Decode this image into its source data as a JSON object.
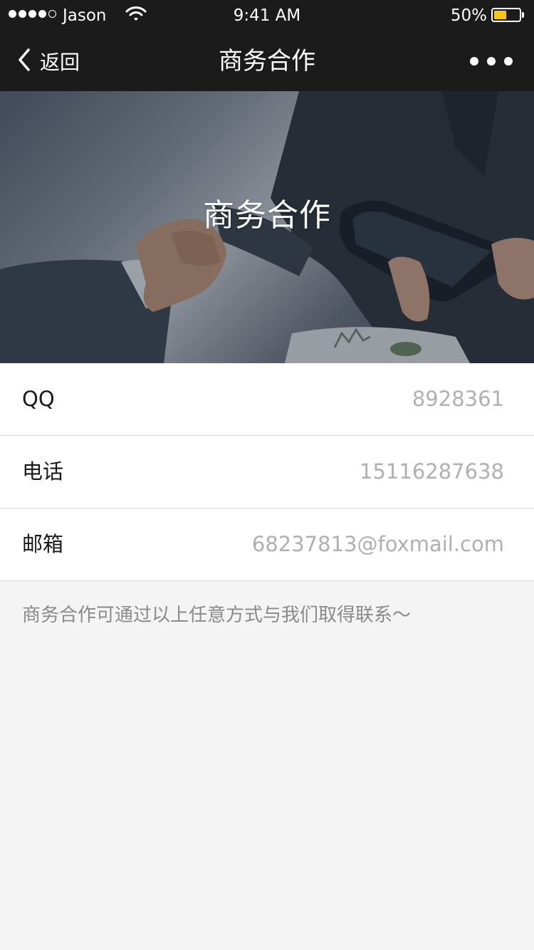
{
  "status_bar": {
    "carrier": "Jason",
    "time": "9:41 AM",
    "battery_percent": "50%",
    "battery_level": 0.5,
    "signal_bars_filled": 4,
    "signal_bars_total": 5,
    "icons": [
      "signal-dots-icon",
      "wifi-icon",
      "battery-icon"
    ]
  },
  "nav": {
    "back_label": "返回",
    "title": "商务合作",
    "back_icon": "chevron-left-icon",
    "more_icon": "more-dots-icon"
  },
  "banner": {
    "title": "商务合作"
  },
  "contacts": [
    {
      "label": "QQ",
      "value": "8928361"
    },
    {
      "label": "电话",
      "value": "15116287638"
    },
    {
      "label": "邮箱",
      "value": "68237813@foxmail.com"
    }
  ],
  "footer": {
    "note": "商务合作可通过以上任意方式与我们取得联系～"
  },
  "colors": {
    "bar_background": "#1b1b1b",
    "battery_fill": "#f5c51f",
    "page_background": "#f4f4f4",
    "value_text": "#b0b0b0"
  }
}
